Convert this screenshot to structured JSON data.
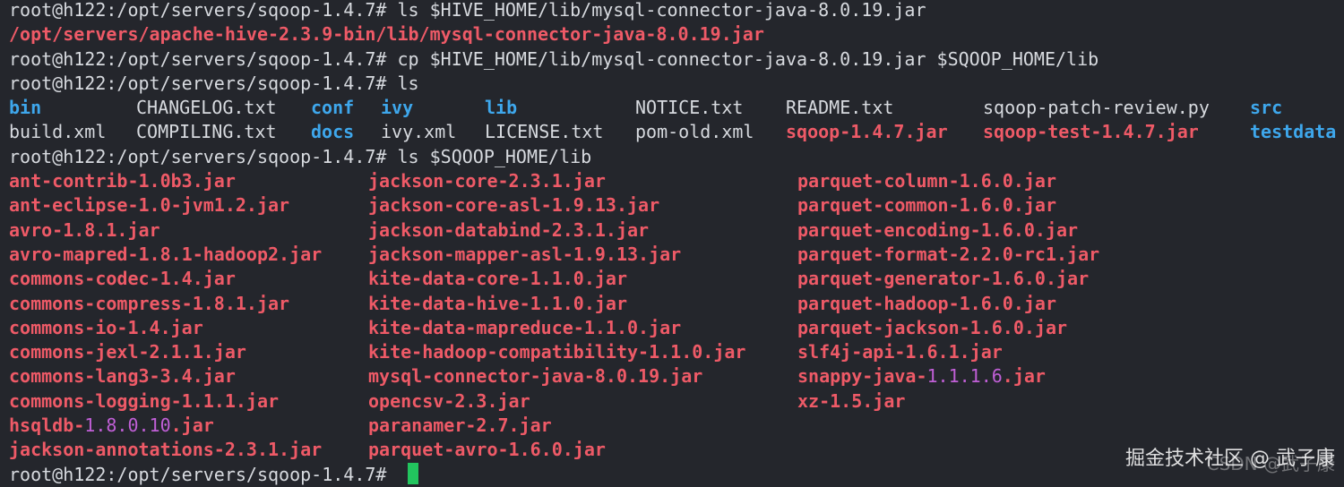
{
  "terminal": {
    "prompt": "root@h122:/opt/servers/sqoop-1.4.7# ",
    "cmd1": "ls $HIVE_HOME/lib/mysql-connector-java-8.0.19.jar",
    "out1": "/opt/servers/apache-hive-2.3.9-bin/lib/mysql-connector-java-8.0.19.jar",
    "cmd2": "cp $HIVE_HOME/lib/mysql-connector-java-8.0.19.jar $SQOOP_HOME/lib",
    "cmd3": "ls",
    "ls_row1": [
      "bin",
      "CHANGELOG.txt",
      "conf",
      "ivy",
      "lib",
      "NOTICE.txt",
      "README.txt",
      "sqoop-patch-review.py",
      "src"
    ],
    "ls_row2": [
      "build.xml",
      "COMPILING.txt",
      "docs",
      "ivy.xml",
      "LICENSE.txt",
      "pom-old.xml",
      "sqoop-1.4.7.jar",
      "sqoop-test-1.4.7.jar",
      "testdata"
    ],
    "cmd4": "ls $SQOOP_HOME/lib",
    "lib_col1": [
      "ant-contrib-1.0b3.jar",
      "ant-eclipse-1.0-jvm1.2.jar",
      "avro-1.8.1.jar",
      "avro-mapred-1.8.1-hadoop2.jar",
      "commons-codec-1.4.jar",
      "commons-compress-1.8.1.jar",
      "commons-io-1.4.jar",
      "commons-jexl-2.1.1.jar",
      "commons-lang3-3.4.jar",
      "commons-logging-1.1.1.jar",
      "hsqldb-",
      "jackson-annotations-2.3.1.jar"
    ],
    "hsqldb_version": "1.8.0.10",
    "hsqldb_suffix": ".jar",
    "lib_col2": [
      "jackson-core-2.3.1.jar",
      "jackson-core-asl-1.9.13.jar",
      "jackson-databind-2.3.1.jar",
      "jackson-mapper-asl-1.9.13.jar",
      "kite-data-core-1.1.0.jar",
      "kite-data-hive-1.1.0.jar",
      "kite-data-mapreduce-1.1.0.jar",
      "kite-hadoop-compatibility-1.1.0.jar",
      "mysql-connector-java-8.0.19.jar",
      "opencsv-2.3.jar",
      "paranamer-2.7.jar",
      "parquet-avro-1.6.0.jar"
    ],
    "lib_col3": [
      "parquet-column-1.6.0.jar",
      "parquet-common-1.6.0.jar",
      "parquet-encoding-1.6.0.jar",
      "parquet-format-2.2.0-rc1.jar",
      "parquet-generator-1.6.0.jar",
      "parquet-hadoop-1.6.0.jar",
      "parquet-jackson-1.6.0.jar",
      "slf4j-api-1.6.1.jar",
      "snappy-java-",
      "xz-1.5.jar"
    ],
    "snappy_version": "1.1.1.6",
    "snappy_suffix": ".jar",
    "cursor_icon": "block-cursor"
  },
  "watermark": {
    "text": "掘金技术社区 @ 武子康",
    "ghost": "CSDN @武子康"
  },
  "colors": {
    "background": "#24262c",
    "text": "#d7dadf",
    "jar_red": "#ee5a67",
    "dir_blue": "#3ea7ec",
    "version_magenta": "#c05fd6",
    "cursor_green": "#22c55e"
  }
}
